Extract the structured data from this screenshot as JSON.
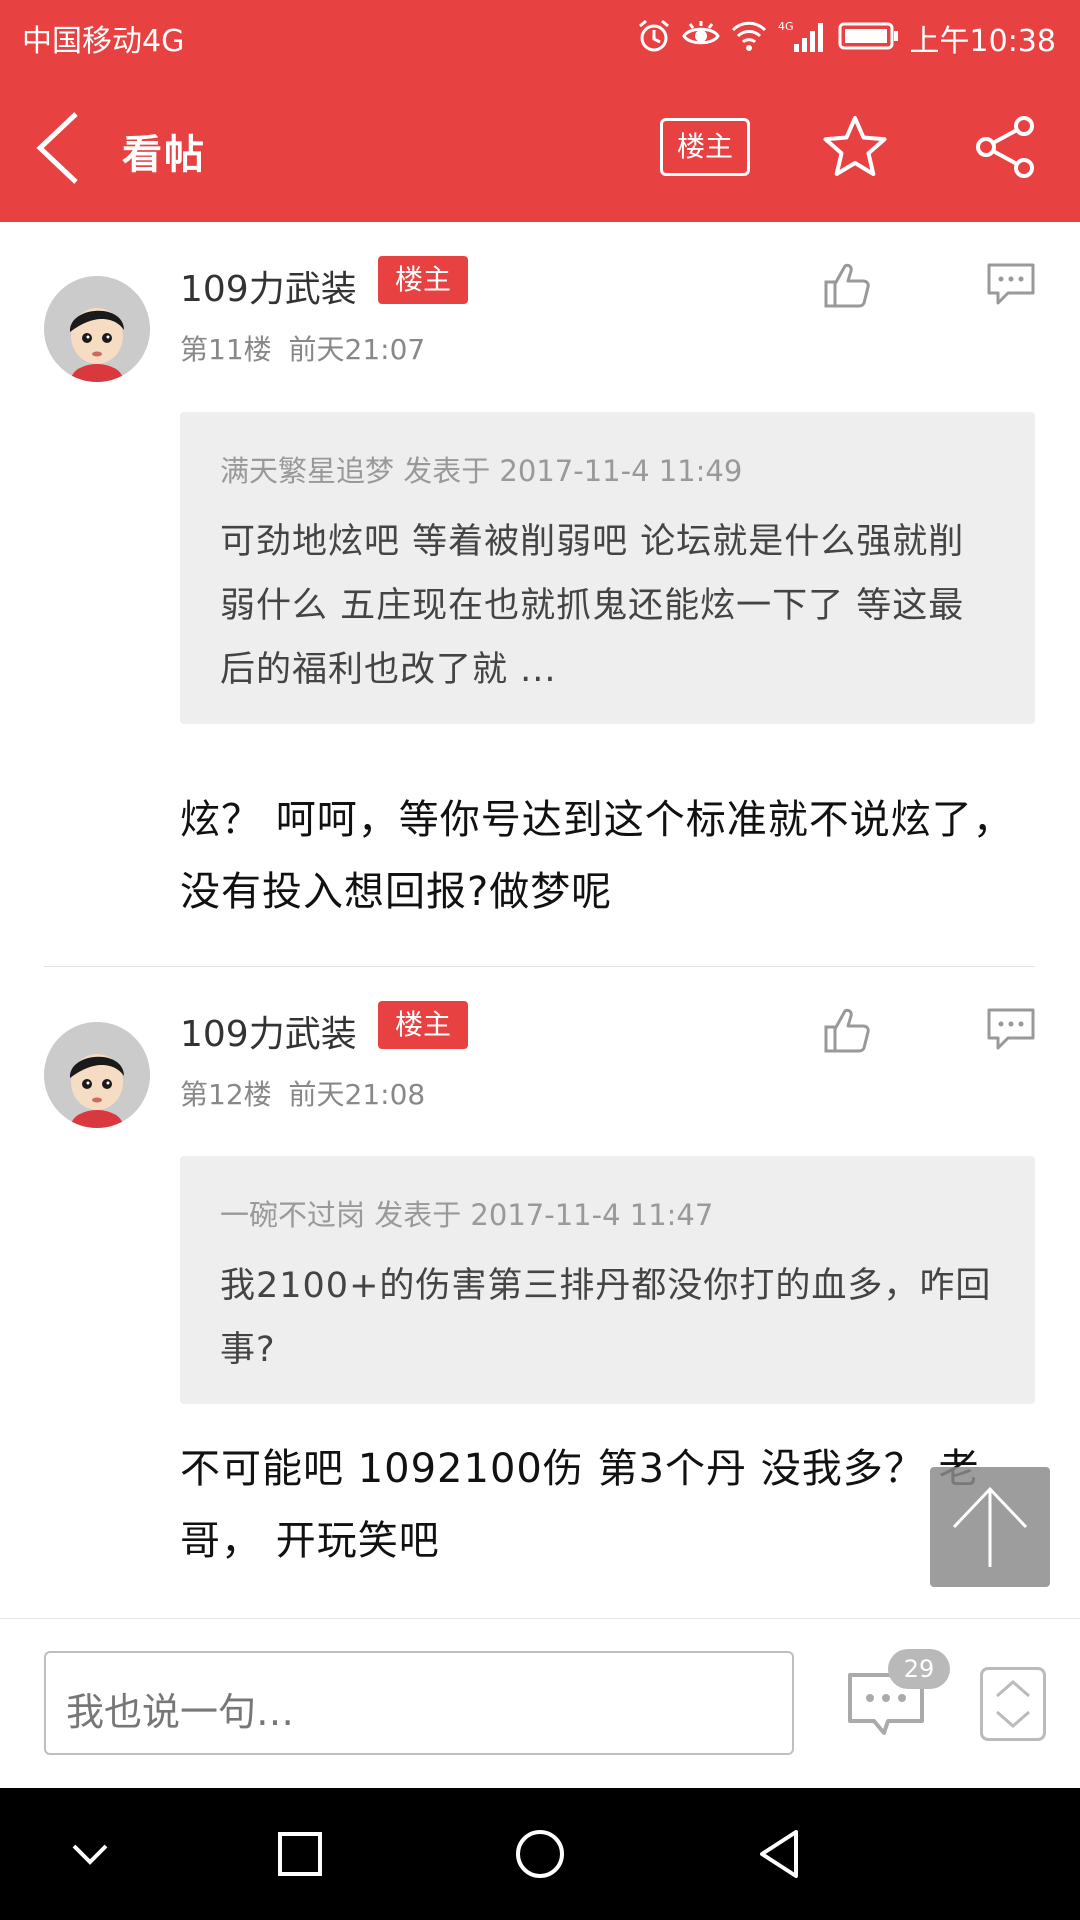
{
  "status_bar": {
    "carrier": "中国移动4G",
    "time": "上午10:38",
    "icons": [
      "alarm-icon",
      "eye-icon",
      "wifi-icon",
      "4g-signal-icon",
      "battery-icon"
    ]
  },
  "app_bar": {
    "back_icon": "chevron-left-icon",
    "title": "看帖",
    "owner_button": "楼主",
    "favorite_icon": "star-icon",
    "share_icon": "share-icon"
  },
  "posts": [
    {
      "username": "109力武装",
      "badge": "楼主",
      "meta": "第11楼 前天21:07",
      "quote_header": "满天繁星追梦 发表于 2017-11-4 11:49",
      "quote_body": "可劲地炫吧 等着被削弱吧 论坛就是什么强就削弱什么 五庄现在也就抓鬼还能炫一下了 等这最后的福利也改了就 ...",
      "reply": "炫？ 呵呵，等你号达到这个标准就不说炫了，没有投入想回报?做梦呢"
    },
    {
      "username": "109力武装",
      "badge": "楼主",
      "meta": "第12楼 前天21:08",
      "quote_header": "一碗不过岗 发表于 2017-11-4 11:47",
      "quote_body": "我2100+的伤害第三排丹都没你打的血多，咋回事?",
      "reply": "不可能吧 1092100伤 第3个丹 没我多？ 老哥， 开玩笑吧"
    }
  ],
  "bottom_bar": {
    "input_placeholder": "我也说一句…",
    "comment_count": "29"
  },
  "nav_bar": {
    "icons": [
      "collapse-icon",
      "recents-icon",
      "home-icon",
      "back-icon"
    ]
  },
  "colors": {
    "brand_red": "#e84142",
    "quote_bg": "#eeeeee"
  }
}
